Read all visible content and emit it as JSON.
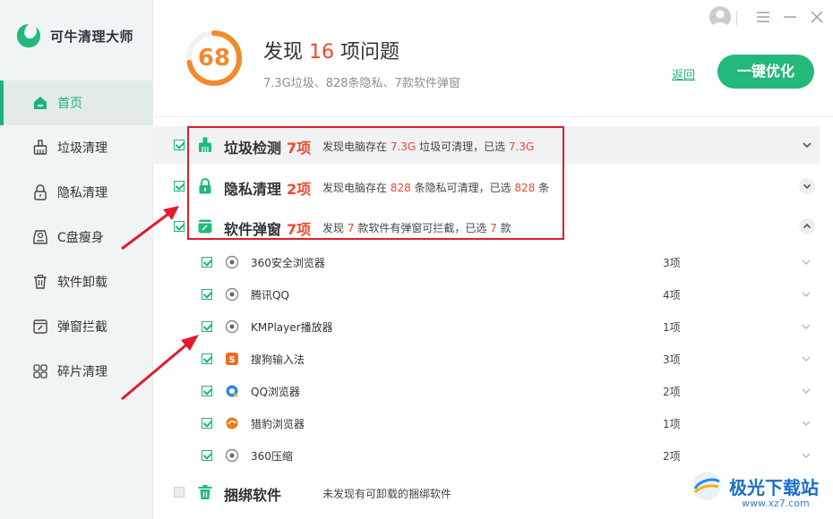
{
  "app": {
    "name": "可牛清理大师"
  },
  "sidebar": {
    "items": [
      {
        "label": "首页",
        "icon": "home-icon",
        "active": true
      },
      {
        "label": "垃圾清理",
        "icon": "broom-icon"
      },
      {
        "label": "隐私清理",
        "icon": "lock-icon"
      },
      {
        "label": "C盘瘦身",
        "icon": "disk-icon"
      },
      {
        "label": "软件卸载",
        "icon": "trash-icon"
      },
      {
        "label": "弹窗拦截",
        "icon": "popup-icon"
      },
      {
        "label": "碎片清理",
        "icon": "grid-icon"
      }
    ]
  },
  "header": {
    "score": "68",
    "title_prefix": "发现",
    "title_count": "16",
    "title_suffix": "项问题",
    "subtitle": "7.3G垃圾、828条隐私、7款软件弹窗",
    "back_label": "返回",
    "optimize_label": "一键优化"
  },
  "categories": [
    {
      "name": "垃圾检测",
      "count": "7项",
      "desc_1": "发现电脑存在",
      "v1": "7.3G",
      "desc_2": "垃圾可清理，已选",
      "v2": "7.3G",
      "desc_3": ""
    },
    {
      "name": "隐私清理",
      "count": "2项",
      "desc_1": "发现电脑存在",
      "v1": "828",
      "desc_2": "条隐私可清理，已选",
      "v2": "828",
      "desc_3": "条"
    },
    {
      "name": "软件弹窗",
      "count": "7项",
      "desc_1": "发现",
      "v1": "7",
      "desc_2": "款软件有弹窗可拦截，已选",
      "v2": "7",
      "desc_3": "款"
    }
  ],
  "software": [
    {
      "name": "360安全浏览器",
      "count": "3项"
    },
    {
      "name": "腾讯QQ",
      "count": "4项"
    },
    {
      "name": "KMPlayer播放器",
      "count": "1项"
    },
    {
      "name": "搜狗输入法",
      "count": "3项"
    },
    {
      "name": "QQ浏览器",
      "count": "2项"
    },
    {
      "name": "猎豹浏览器",
      "count": "1项"
    },
    {
      "name": "360压缩",
      "count": "2项"
    }
  ],
  "bundle": {
    "name": "捆绑软件",
    "desc": "未发现有可卸载的捆绑软件"
  },
  "watermark": {
    "text": "极光下载站",
    "url": "www.xz7.com"
  },
  "colors": {
    "accent": "#1cb37a",
    "alert": "#f0462e",
    "score": "#f28a2b",
    "annotation": "#e01d2a"
  }
}
